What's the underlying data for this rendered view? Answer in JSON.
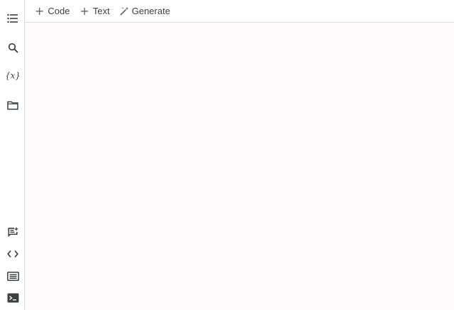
{
  "toolbar": {
    "code_label": "Code",
    "text_label": "Text",
    "generate_label": "Generate"
  },
  "sidebar": {
    "top_icons": [
      "table-of-contents-icon",
      "search-icon",
      "variables-icon",
      "files-icon"
    ],
    "bottom_icons": [
      "feedback-icon",
      "code-snippets-icon",
      "command-palette-icon",
      "terminal-icon"
    ]
  },
  "colors": {
    "border": "#dadce0",
    "icon": "#3c4043",
    "canvas": "#fffbfc"
  }
}
